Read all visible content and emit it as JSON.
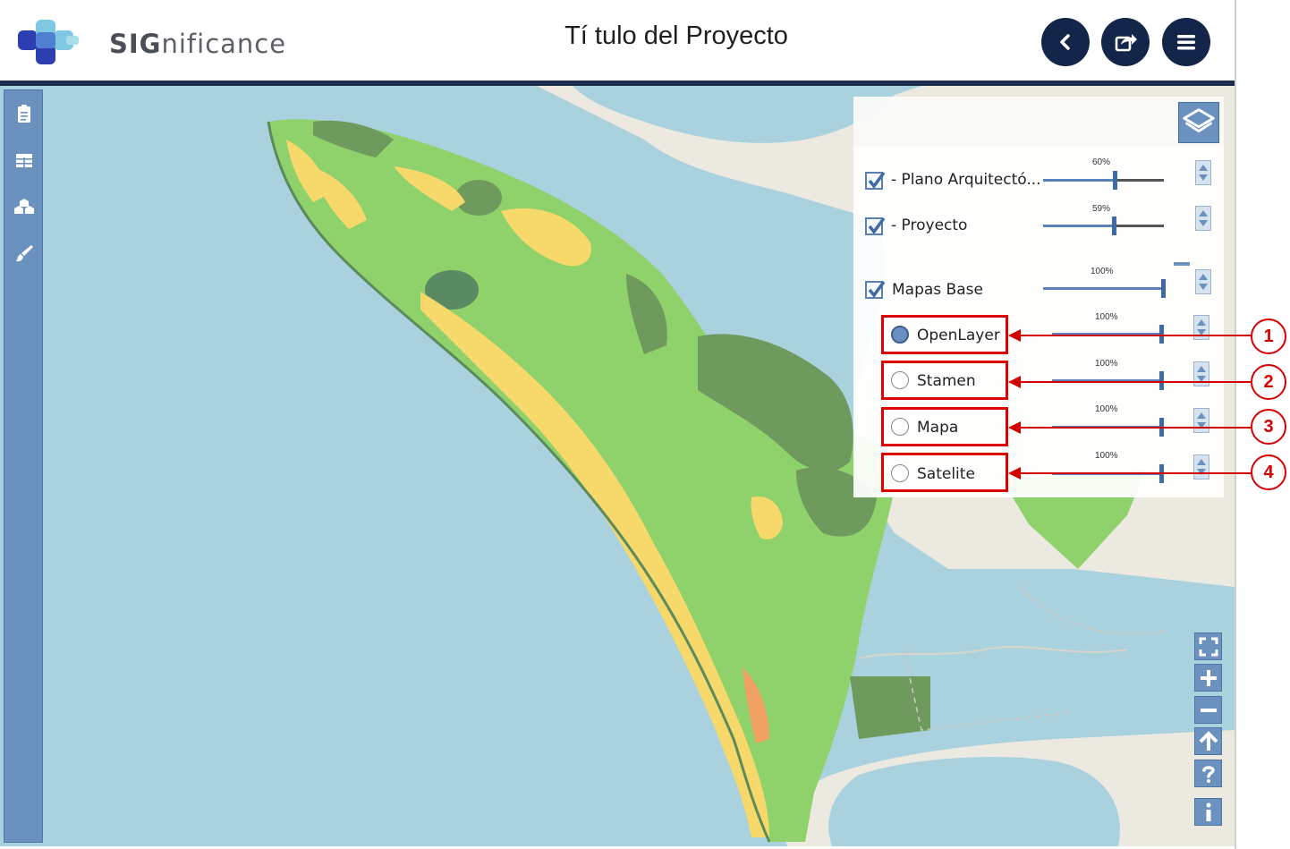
{
  "header": {
    "brand_bold": "SIG",
    "brand_rest": "nificance",
    "project_title": "Tí tulo del Proyecto",
    "buttons": [
      {
        "name": "back",
        "icon": "chevron-left-icon"
      },
      {
        "name": "share",
        "icon": "share-icon"
      },
      {
        "name": "menu",
        "icon": "hamburger-icon"
      }
    ]
  },
  "sidebar": {
    "items": [
      {
        "icon": "clipboard-icon"
      },
      {
        "icon": "table-icon"
      },
      {
        "icon": "cubes-icon"
      },
      {
        "icon": "brush-icon"
      }
    ]
  },
  "layer_panel": {
    "toggle_icon": "layers-icon",
    "overlays": [
      {
        "label": "- Plano Arquitectó...",
        "checked": true,
        "opacity": "60%",
        "opacity_value": 0.6
      },
      {
        "label": "- Proyecto",
        "checked": true,
        "opacity": "59%",
        "opacity_value": 0.59
      }
    ],
    "base_group": {
      "label": "Mapas Base",
      "checked": true,
      "opacity": "100%",
      "opacity_value": 1.0
    },
    "base_maps": [
      {
        "label": "OpenLayer",
        "selected": true,
        "opacity": "100%",
        "callout": "1"
      },
      {
        "label": "Stamen",
        "selected": false,
        "opacity": "100%",
        "callout": "2"
      },
      {
        "label": "Mapa",
        "selected": false,
        "opacity": "100%",
        "callout": "3"
      },
      {
        "label": "Satelite",
        "selected": false,
        "opacity": "100%",
        "callout": "4"
      }
    ]
  },
  "map_controls": [
    {
      "icon": "fullscreen-icon"
    },
    {
      "icon": "zoom-in-icon"
    },
    {
      "icon": "zoom-out-icon"
    },
    {
      "icon": "arrow-up-icon"
    },
    {
      "icon": "help-icon"
    },
    {
      "icon": "info-icon"
    }
  ],
  "colors": {
    "header_dark": "#14254a",
    "sidebar": "#6b91bf",
    "water": "#a9d2de",
    "land": "#ece9e1",
    "vegetation": "#8fd16a",
    "dark_vegetation": "#6e9a5e",
    "sand": "#f6d86b",
    "callout_red": "#e00000"
  }
}
